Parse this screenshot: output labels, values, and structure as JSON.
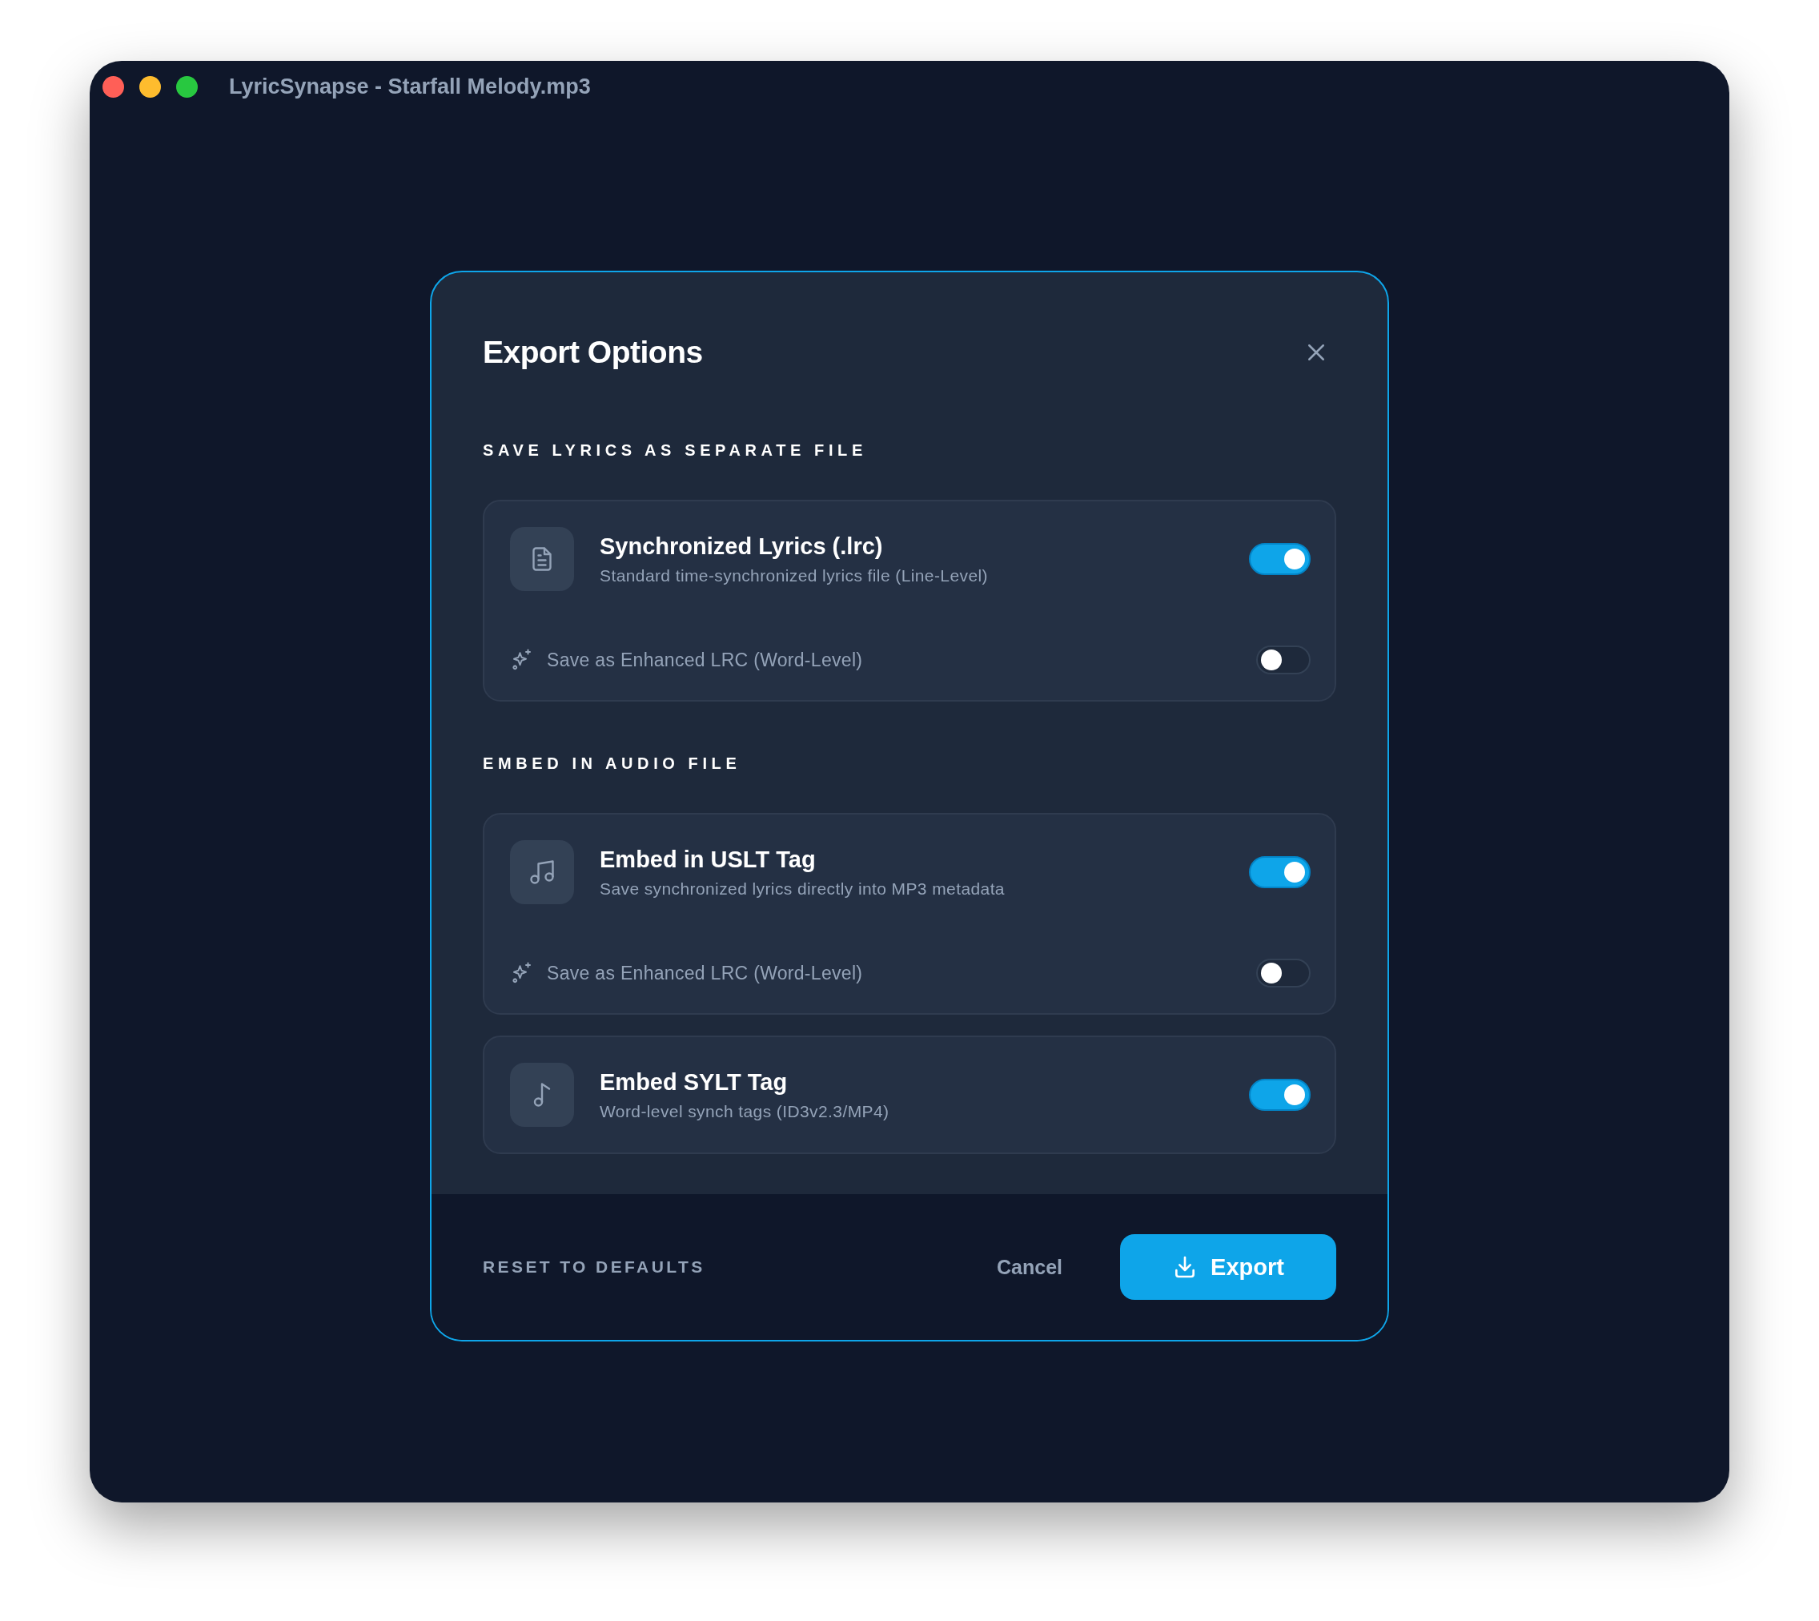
{
  "window": {
    "title": "LyricSynapse - Starfall Melody.mp3"
  },
  "dialog": {
    "title": "Export Options",
    "sections": [
      {
        "title": "SAVE LYRICS AS SEPARATE FILE",
        "cards": [
          {
            "kind": "document",
            "title": "Synchronized Lyrics (.lrc)",
            "description": "Standard time-synchronized lyrics file (Line-Level)",
            "on": true,
            "sub_option": {
              "label": "Save as Enhanced LRC (Word-Level)",
              "on": false
            }
          }
        ]
      },
      {
        "title": "EMBED IN AUDIO FILE",
        "cards": [
          {
            "kind": "notes",
            "title": "Embed in USLT Tag",
            "description": "Save synchronized lyrics directly into MP3 metadata",
            "on": true,
            "sub_option": {
              "label": "Save as Enhanced LRC (Word-Level)",
              "on": false
            }
          },
          {
            "kind": "note",
            "title": "Embed SYLT Tag",
            "description": "Word-level synch tags (ID3v2.3/MP4)",
            "on": true
          }
        ]
      }
    ],
    "footer": {
      "reset": "RESET TO DEFAULTS",
      "cancel": "Cancel",
      "export": "Export"
    }
  }
}
